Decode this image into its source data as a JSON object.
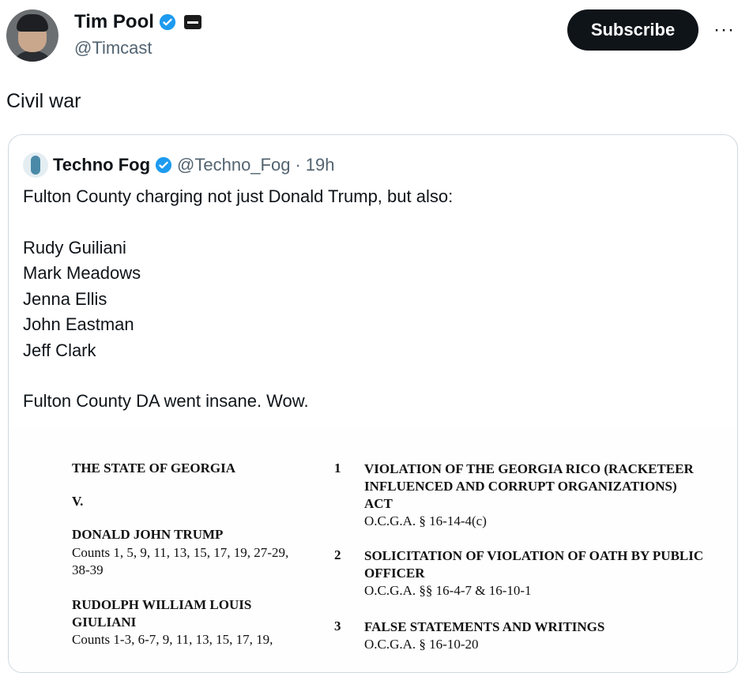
{
  "author": {
    "name": "Tim Pool",
    "handle": "@Timcast"
  },
  "actions": {
    "subscribe_label": "Subscribe",
    "more_label": "···"
  },
  "tweet": {
    "text": "Civil war"
  },
  "quoted": {
    "name": "Techno Fog",
    "handle": "@Techno_Fog",
    "separator": "·",
    "time": "19h",
    "lines": [
      "Fulton County charging not just Donald Trump, but also:",
      "",
      "Rudy Guiliani",
      "Mark Meadows",
      "Jenna Ellis",
      "John Eastman",
      "Jeff Clark",
      "",
      "Fulton County DA went insane. Wow."
    ]
  },
  "document": {
    "state": "THE STATE OF GEORGIA",
    "versus": "V.",
    "defendant1": "DONALD JOHN TRUMP",
    "defendant1_counts": "Counts 1, 5, 9, 11, 13, 15, 17, 19, 27-29, 38-39",
    "defendant2": "RUDOLPH WILLIAM LOUIS GIULIANI",
    "defendant2_counts": "Counts 1-3, 6-7, 9, 11, 13, 15, 17, 19,",
    "counts": [
      {
        "num": "1",
        "title": "VIOLATION OF THE GEORGIA RICO (RACKETEER INFLUENCED AND CORRUPT ORGANIZATIONS) ACT",
        "code": "O.C.G.A. § 16-14-4(c)"
      },
      {
        "num": "2",
        "title": "SOLICITATION OF VIOLATION OF OATH BY PUBLIC OFFICER",
        "code": "O.C.G.A. §§ 16-4-7 & 16-10-1"
      },
      {
        "num": "3",
        "title": "FALSE STATEMENTS AND WRITINGS",
        "code": "O.C.G.A. § 16-10-20"
      }
    ]
  },
  "colors": {
    "verified": "#1d9bf0",
    "muted": "#536471",
    "border": "#cfd9de"
  }
}
